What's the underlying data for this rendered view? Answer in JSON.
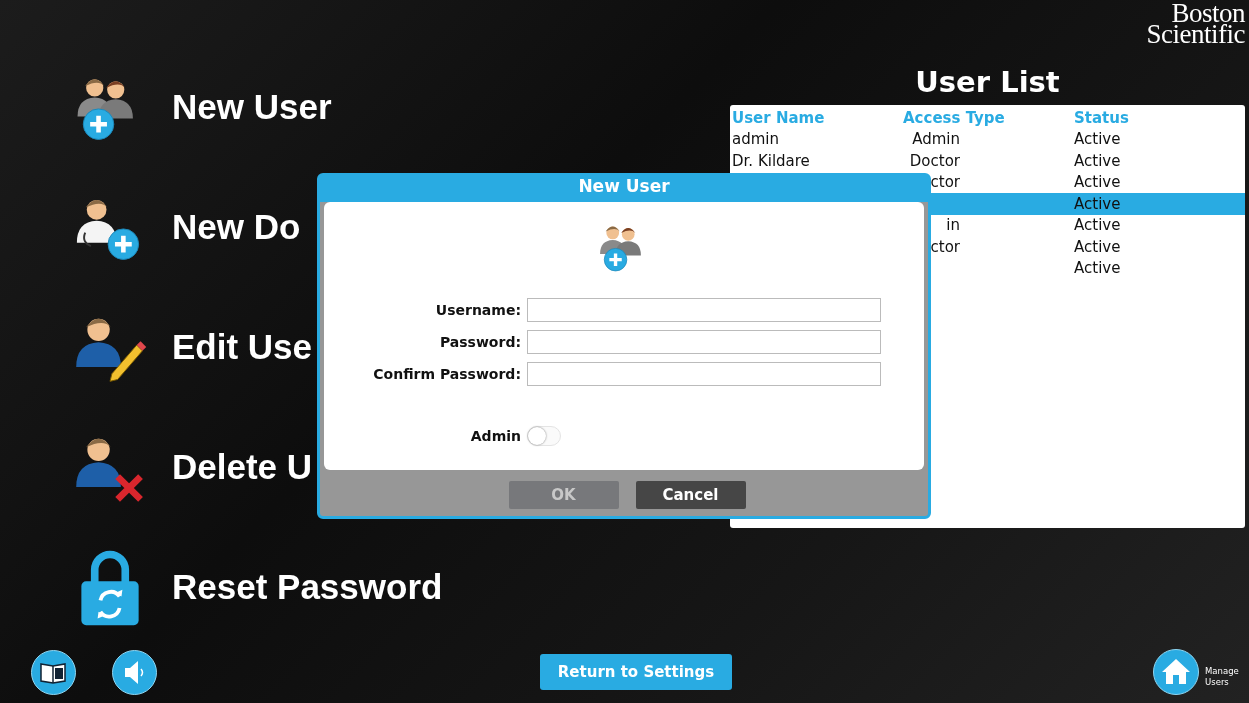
{
  "logo": {
    "line_1": "Boston",
    "line_2": "Scientific"
  },
  "menu": [
    {
      "kind": "new_user",
      "label": "New User"
    },
    {
      "kind": "new_doctor",
      "label": "New Do"
    },
    {
      "kind": "edit_user",
      "label": "Edit Use"
    },
    {
      "kind": "delete_user",
      "label": "Delete U"
    },
    {
      "kind": "reset_password",
      "label": "Reset Password"
    }
  ],
  "user_list": {
    "title": "User List",
    "columns": [
      "User Name",
      "Access Type",
      "Status"
    ],
    "rows": [
      {
        "user_name": "admin",
        "access_type": "Admin",
        "status": "Active",
        "selected": false
      },
      {
        "user_name": "Dr. Kildare",
        "access_type": "Doctor",
        "status": "Active",
        "selected": false
      },
      {
        "access_type": "ctor",
        "status": "Active",
        "selected": false
      },
      {
        "status": "Active",
        "selected": true
      },
      {
        "access_type": "in",
        "status": "Active",
        "selected": false
      },
      {
        "access_type": "ctor",
        "status": "Active",
        "selected": false
      },
      {
        "status": "Active",
        "selected": false
      }
    ]
  },
  "dialog": {
    "title": "New User",
    "fields": [
      {
        "label": "Username:"
      },
      {
        "label": "Password:"
      },
      {
        "label": "Confirm Password:"
      }
    ],
    "admin_toggle": {
      "label": "Admin",
      "on": false
    },
    "buttons": [
      {
        "label": "OK",
        "disabled": true
      },
      {
        "label": "Cancel",
        "disabled": false
      }
    ]
  },
  "bottom_bar": {
    "return_button": "Return to Settings",
    "home_caption": "Manage Users"
  }
}
